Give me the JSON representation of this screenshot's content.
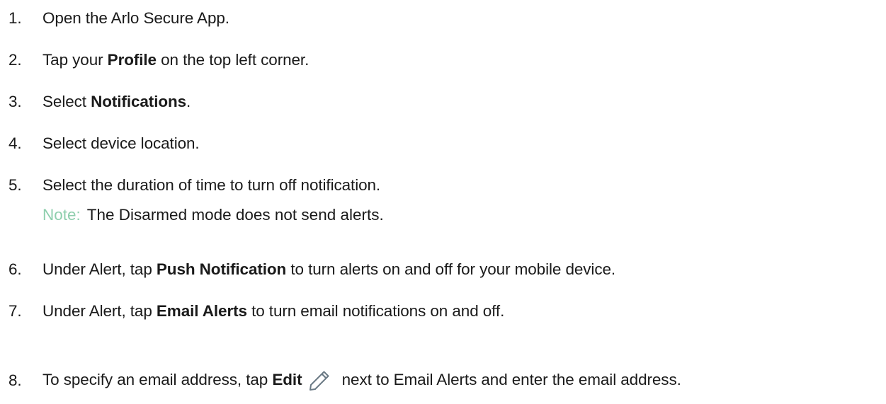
{
  "steps": [
    {
      "number": "1.",
      "parts": [
        "Open the Arlo Secure App."
      ]
    },
    {
      "number": "2.",
      "before": "Tap your ",
      "bold": "Profile",
      "after": " on the top left corner."
    },
    {
      "number": "3.",
      "before": "Select ",
      "bold": "Notifications",
      "after": "."
    },
    {
      "number": "4.",
      "parts": [
        "Select device location."
      ]
    },
    {
      "number": "5.",
      "parts": [
        "Select the duration of time to turn off notification."
      ]
    },
    {
      "number": "6.",
      "before": "Under Alert, tap ",
      "bold": "Push Notification",
      "after": " to turn alerts on and off for your mobile device."
    },
    {
      "number": "7.",
      "before": "Under Alert, tap ",
      "bold": "Email Alerts",
      "after": " to turn email notifications on and off."
    },
    {
      "number": "8.",
      "before": "To specify an email address, tap ",
      "bold": "Edit",
      "after": " next to Email Alerts and enter the email address."
    }
  ],
  "note": {
    "label": "Note:",
    "text": "The Disarmed mode does not send alerts."
  },
  "colors": {
    "note_label": "#8fcfae",
    "text": "#1a1a1a",
    "icon_stroke": "#6b7a85"
  },
  "icons": {
    "edit": "pencil-icon"
  }
}
